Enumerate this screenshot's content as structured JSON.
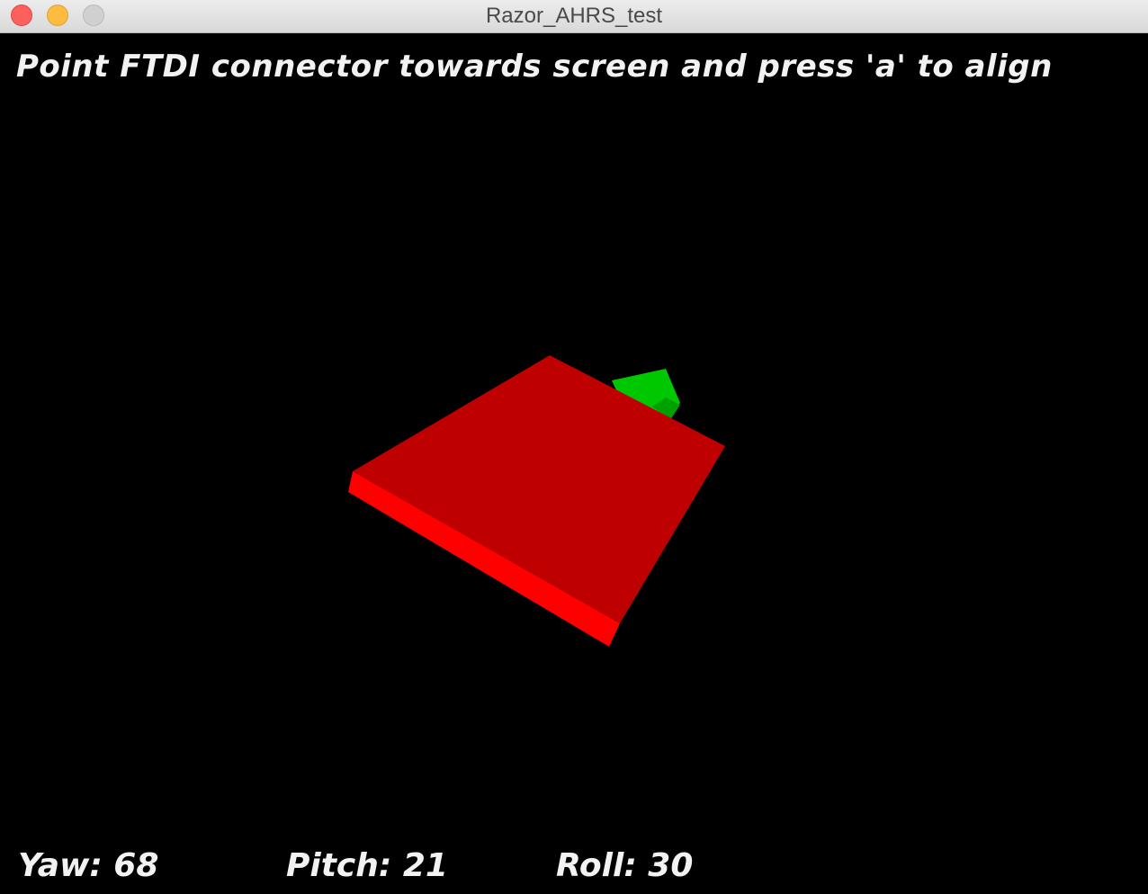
{
  "window": {
    "title": "Razor_AHRS_test"
  },
  "canvas": {
    "instruction": "Point FTDI connector towards screen and press 'a' to align",
    "readouts": {
      "yaw_label": "Yaw: 68",
      "pitch_label": "Pitch: 21",
      "roll_label": "Roll: 30"
    },
    "model": {
      "board_top_color": "#bf0000",
      "board_edge_color": "#ff0000",
      "connector_color": "#00c800",
      "connector_shade_color": "#00a000",
      "background_color": "#000000"
    }
  }
}
